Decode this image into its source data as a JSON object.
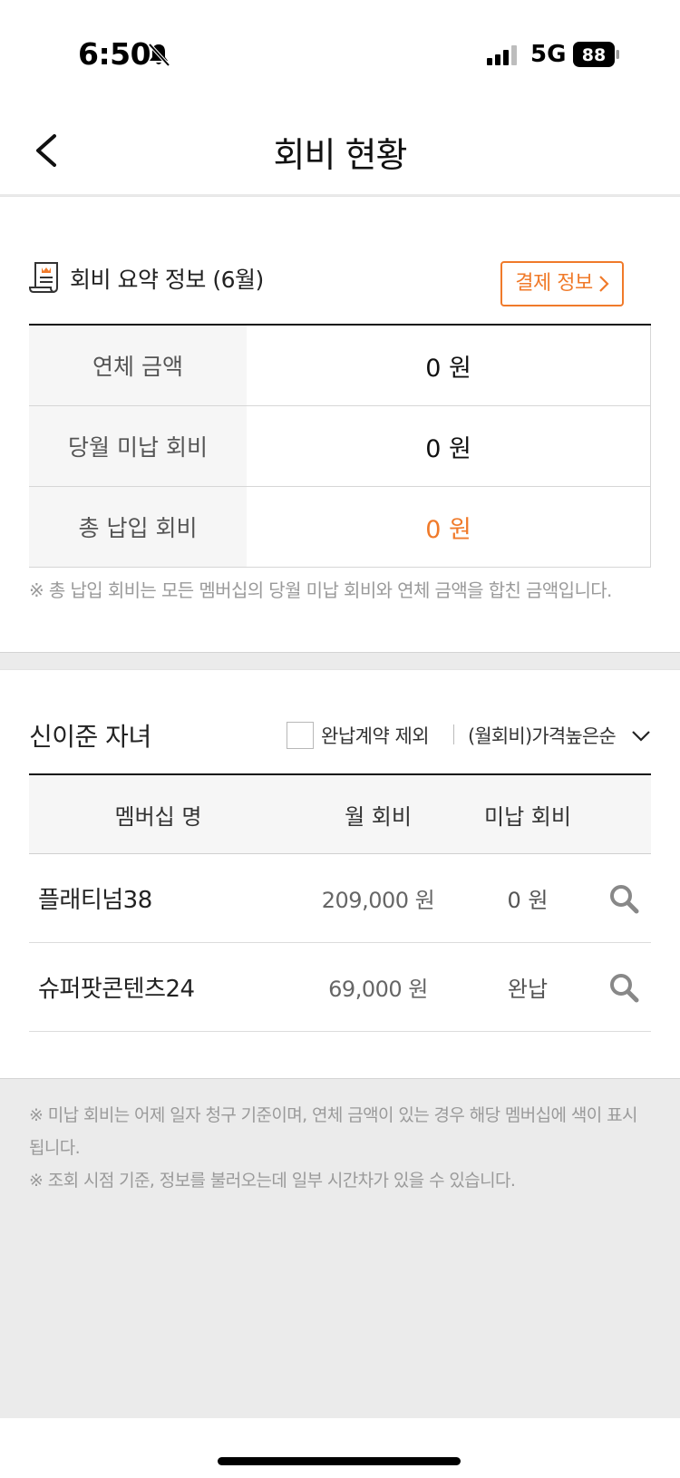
{
  "status_bar": {
    "time": "6:50",
    "network": "5G",
    "battery": "88"
  },
  "header": {
    "title": "회비 현황",
    "back_icon": "chevron-left-icon"
  },
  "summary": {
    "title": "회비 요약 정보 (6월)",
    "payment_button": "결제 정보",
    "rows": [
      {
        "label": "연체 금액",
        "value": "0 원",
        "highlight": false
      },
      {
        "label": "당월 미납 회비",
        "value": "0 원",
        "highlight": false
      },
      {
        "label": "총 납입 회비",
        "value": "0 원",
        "highlight": true
      }
    ],
    "note": "※ 총 납입 회비는 모든 멤버십의 당월 미납 회비와 연체 금액을 합친 금액입니다."
  },
  "membership": {
    "child_name": "신이준 자녀",
    "exclude_label": "완납계약 제외",
    "exclude_checked": false,
    "sort_label": "(월회비)가격높은순",
    "headers": {
      "name": "멤버십 명",
      "fee": "월 회비",
      "unpaid": "미납 회비"
    },
    "rows": [
      {
        "name": "플래티넘38",
        "fee": "209,000 원",
        "unpaid": "0 원"
      },
      {
        "name": "슈퍼팟콘텐츠24",
        "fee": "69,000 원",
        "unpaid": "완납"
      }
    ]
  },
  "footer_notes": [
    "※ 미납 회비는 어제 일자 청구 기준이며, 연체 금액이 있는 경우 해당 멤버십에 색이 표시됩니다.",
    "※ 조회 시점 기준, 정보를 불러오는데 일부 시간차가 있을 수 있습니다."
  ],
  "colors": {
    "accent": "#f07a2a"
  }
}
